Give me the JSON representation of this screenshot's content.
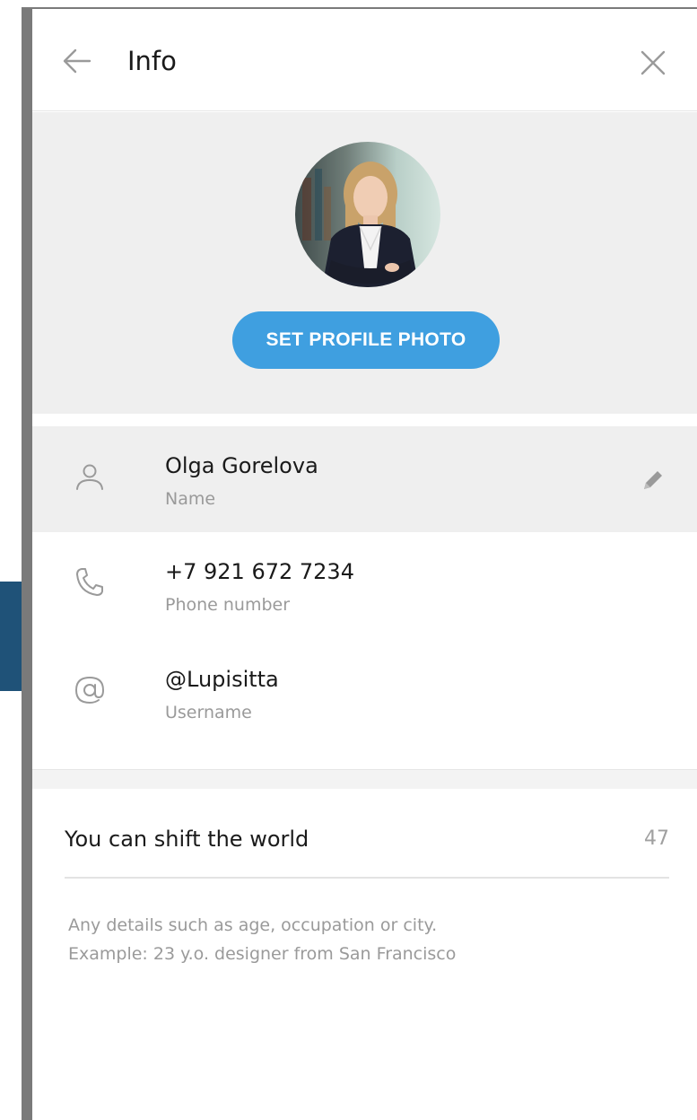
{
  "header": {
    "title": "Info",
    "back_icon": "arrow-left-icon",
    "close_icon": "close-icon"
  },
  "profile": {
    "set_photo_label": "SET PROFILE PHOTO"
  },
  "info_rows": [
    {
      "icon": "user-icon",
      "primary": "Olga Gorelova",
      "secondary": "Name",
      "editable": true
    },
    {
      "icon": "phone-icon",
      "primary": "+7 921 672 7234",
      "secondary": "Phone number"
    },
    {
      "icon": "at-icon",
      "primary": "@Lupisitta",
      "secondary": "Username"
    }
  ],
  "bio": {
    "value": "You can shift the world",
    "counter": "47",
    "hint_lines": [
      "Any details such as age, occupation or city.",
      "Example: 23 y.o. designer from San Francisco"
    ]
  },
  "colors": {
    "accent": "#3f9fe0",
    "section_bg": "#efefef",
    "muted_text": "#9a9a9a"
  }
}
